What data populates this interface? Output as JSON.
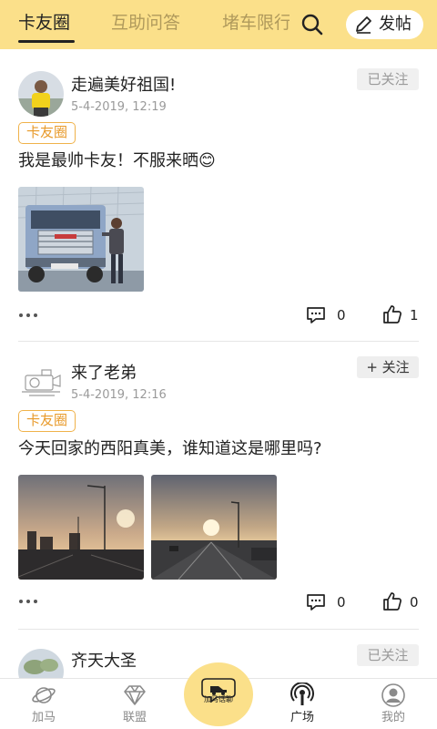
{
  "header": {
    "tabs": [
      {
        "label": "卡友圈",
        "active": true
      },
      {
        "label": "互助问答",
        "active": false
      },
      {
        "label": "堵车限行",
        "active": false
      }
    ],
    "search_icon": "search-icon",
    "post_button_label": "发帖",
    "post_icon": "pencil-icon",
    "background_color": "#fbe08a"
  },
  "feed": [
    {
      "username": "走遍美好祖国!",
      "time": "5-4-2019, 12:19",
      "follow_label": "已关注",
      "followed": true,
      "tag": "卡友圈",
      "content": "我是最帅卡友！不服来晒😊",
      "photos": [
        "truck-photo"
      ],
      "comment_count": "0",
      "like_count": "1"
    },
    {
      "username": "来了老弟",
      "time": "5-4-2019, 12:16",
      "follow_label": "+ 关注",
      "followed": false,
      "tag": "卡友圈",
      "content": "今天回家的西阳真美，谁知道这是哪里吗?",
      "photos": [
        "sunset-photo",
        "sunset-road-photo"
      ],
      "comment_count": "0",
      "like_count": "0"
    },
    {
      "username": "齐天大圣",
      "follow_label": "已关注",
      "followed": true
    }
  ],
  "bottom_nav": {
    "items": [
      {
        "label": "加马",
        "icon": "planet-icon",
        "active": false
      },
      {
        "label": "联盟",
        "icon": "diamond-icon",
        "active": false
      },
      {
        "label": "广场",
        "icon": "broadcast-icon",
        "active": true
      },
      {
        "label": "我的",
        "icon": "profile-icon",
        "active": false
      }
    ],
    "center_label": "加马话聊"
  }
}
